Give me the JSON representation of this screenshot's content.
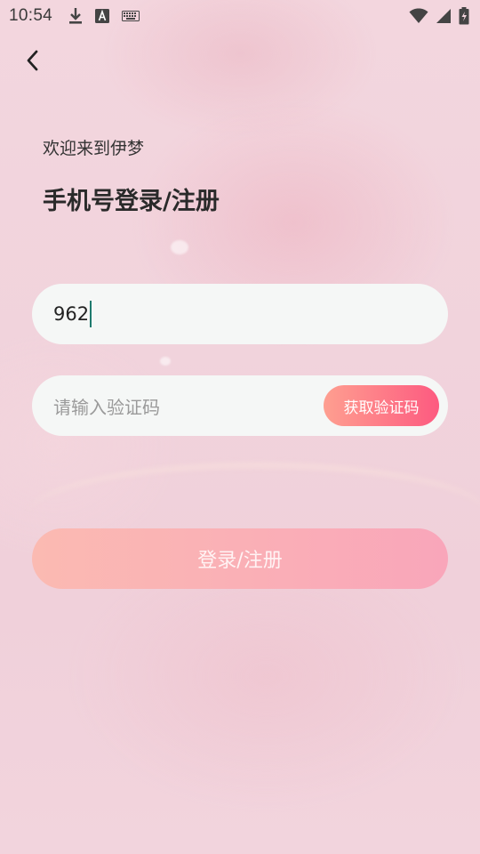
{
  "status_bar": {
    "time": "10:54",
    "left_icons": [
      "download-icon",
      "text-a-icon",
      "keyboard-icon"
    ],
    "right_icons": [
      "wifi-icon",
      "signal-icon",
      "battery-charging-icon"
    ]
  },
  "header": {
    "back_icon": "chevron-left-icon",
    "welcome": "欢迎来到伊梦",
    "title": "手机号登录/注册"
  },
  "form": {
    "phone_value": "962",
    "code_placeholder": "请输入验证码",
    "get_code_label": "获取验证码",
    "submit_label": "登录/注册"
  },
  "colors": {
    "accent_start": "#fe9f90",
    "accent_end": "#fd5a80",
    "caret": "#1e7a6e"
  }
}
